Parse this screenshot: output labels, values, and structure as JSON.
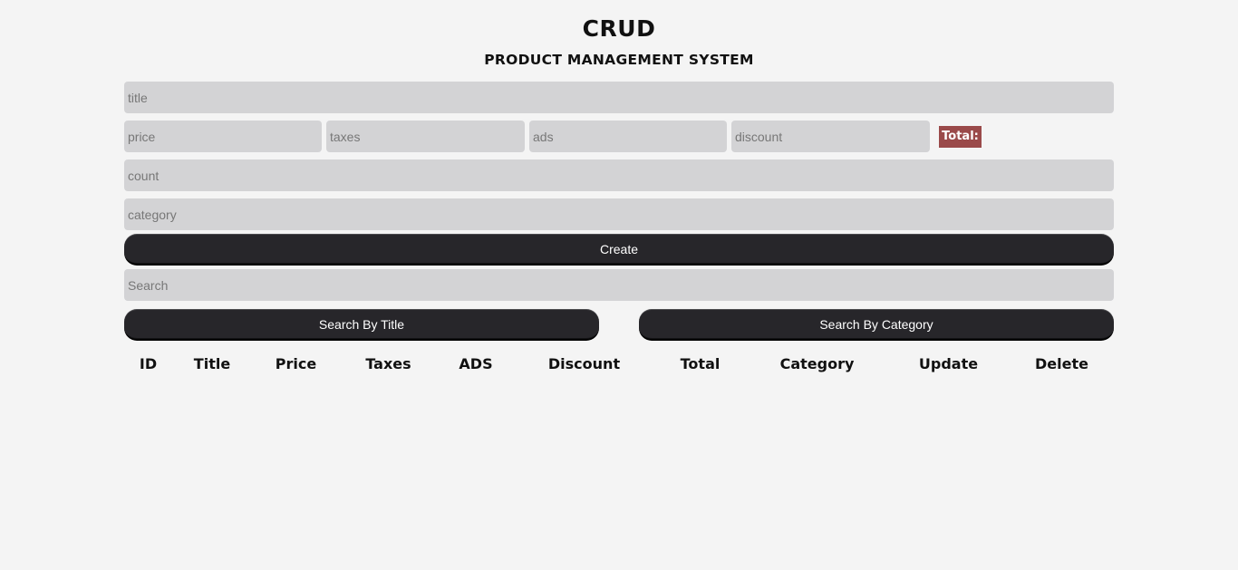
{
  "header": {
    "title": "CRUD",
    "subtitle": "PRODUCT MANAGEMENT SYSTEM"
  },
  "form": {
    "title_placeholder": "title",
    "price_placeholder": "price",
    "taxes_placeholder": "taxes",
    "ads_placeholder": "ads",
    "discount_placeholder": "discount",
    "total_label": "Total:",
    "count_placeholder": "count",
    "category_placeholder": "category",
    "create_label": "Create"
  },
  "search": {
    "placeholder": "Search",
    "by_title_label": "Search By Title",
    "by_category_label": "Search By Category"
  },
  "table": {
    "columns": [
      "ID",
      "Title",
      "Price",
      "Taxes",
      "ADS",
      "Discount",
      "Total",
      "Category",
      "Update",
      "Delete"
    ]
  },
  "colors": {
    "background": "#f4f4f4",
    "input_background": "#d3d3d5",
    "button_background": "#27262a",
    "total_badge": "#9a4a4a"
  }
}
